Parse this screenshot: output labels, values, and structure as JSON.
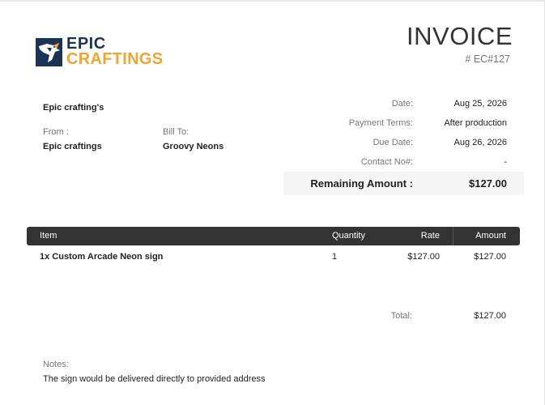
{
  "logo": {
    "line1": "EPIC",
    "line2": "CRAFTINGS",
    "icon": "eagle-logo-icon",
    "brand_navy": "#1d3355",
    "brand_orange": "#f0a431"
  },
  "invoice": {
    "title": "INVOICE",
    "number": "# EC#127"
  },
  "sender": {
    "company": "Epic crafting's",
    "from_label": "From :",
    "from_value": "Epic craftings",
    "bill_to_label": "Bill To:",
    "bill_to_value": "Groovy Neons"
  },
  "meta": [
    {
      "label": "Date:",
      "value": "Aug 25, 2026"
    },
    {
      "label": "Payment Terms:",
      "value": "After production"
    },
    {
      "label": "Due Date:",
      "value": "Aug 26, 2026"
    },
    {
      "label": "Contact No#:",
      "value": "-"
    }
  ],
  "remaining": {
    "label": "Remaining Amount :",
    "value": "$127.00"
  },
  "table": {
    "headers": {
      "item": "Item",
      "quantity": "Quantity",
      "rate": "Rate",
      "amount": "Amount"
    },
    "rows": [
      {
        "item": "1x Custom Arcade Neon sign",
        "quantity": "1",
        "rate": "$127.00",
        "amount": "$127.00"
      }
    ]
  },
  "total": {
    "label": "Total:",
    "value": "$127.00"
  },
  "notes": {
    "label": "Notes:",
    "text": "The sign would be delivered directly to provided address"
  }
}
